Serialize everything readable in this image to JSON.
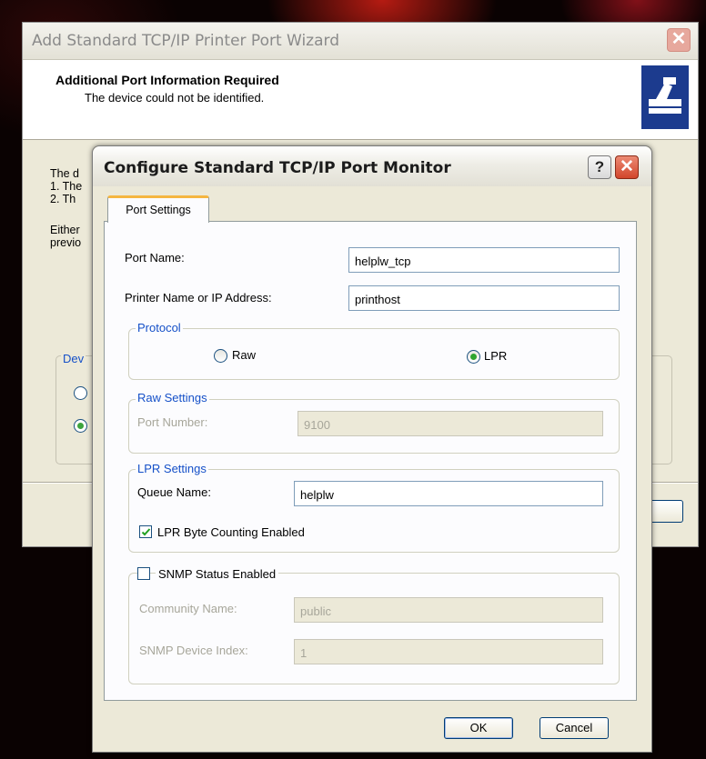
{
  "wizard": {
    "title": "Add Standard TCP/IP Printer Port Wizard",
    "close_glyph": "✕",
    "header_title": "Additional Port Information Required",
    "header_subtitle": "The device could not be identified.",
    "body_fragments": [
      "The d",
      "1. The",
      "2.  Th",
      "Either",
      "previo"
    ],
    "group_fragment": "Dev"
  },
  "dialog": {
    "title": "Configure Standard TCP/IP Port Monitor",
    "help_glyph": "?",
    "close_glyph": "✕",
    "tab_label": "Port Settings",
    "port_name_label": "Port Name:",
    "port_name_value": "helplw_tcp",
    "printer_name_label": "Printer Name or IP Address:",
    "printer_name_value": "printhost",
    "protocol": {
      "label": "Protocol",
      "raw_label": "Raw",
      "lpr_label": "LPR",
      "selected": "LPR"
    },
    "raw_settings": {
      "label": "Raw Settings",
      "port_number_label": "Port Number:",
      "port_number_value": "9100"
    },
    "lpr_settings": {
      "label": "LPR Settings",
      "queue_name_label": "Queue Name:",
      "queue_name_value": "helplw",
      "byte_counting_label": "LPR Byte Counting Enabled",
      "byte_counting_checked": true
    },
    "snmp": {
      "label": "SNMP Status Enabled",
      "checked": false,
      "community_label": "Community Name:",
      "community_value": "public",
      "device_index_label": "SNMP Device Index:",
      "device_index_value": "1"
    },
    "ok_label": "OK",
    "cancel_label": "Cancel"
  },
  "colors": {
    "dialog_bg": "#ECE9D8",
    "group_label": "#1550c8",
    "tab_highlight": "#f5b640",
    "close_red": "#d2462b"
  }
}
